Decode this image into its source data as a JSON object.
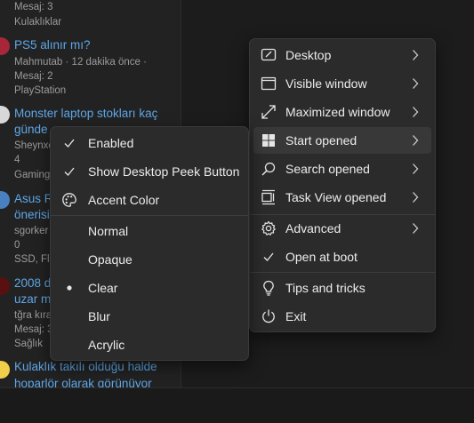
{
  "forum": {
    "posts": [
      {
        "meta1": "Mesaj: 3",
        "category": "Kulaklıklar"
      },
      {
        "title": "PS5 alınır mı?",
        "meta1": "Mahmutab · 12 dakika önce ·",
        "meta2": "Mesaj: 2",
        "category": "PlayStation"
      },
      {
        "title": "Monster laptop stokları kaç",
        "title2": "günde",
        "meta1": "Sheynxo",
        "meta2": "4",
        "category": "Gaming"
      },
      {
        "title": "Asus R",
        "title2": "önerisi",
        "meta1": "sgorker",
        "meta2": "0",
        "category": "SSD, Fla"
      },
      {
        "title": "2008 d",
        "title2": "uzar m",
        "meta1": "tğra kıra",
        "meta2": "Mesaj: 3",
        "category": "Sağlık"
      },
      {
        "title": "Kulaklık takılı olduğu halde",
        "title2": "hoparlör olarak görünüyor"
      }
    ]
  },
  "main_menu": {
    "items": [
      {
        "label": "Desktop",
        "icon": "desktop-icon",
        "submenu": true
      },
      {
        "label": "Visible window",
        "icon": "window-icon",
        "submenu": true
      },
      {
        "label": "Maximized window",
        "icon": "maximize-icon",
        "submenu": true
      },
      {
        "label": "Start opened",
        "icon": "windows-logo-icon",
        "submenu": true
      },
      {
        "label": "Search opened",
        "icon": "search-icon",
        "submenu": true
      },
      {
        "label": "Task View opened",
        "icon": "task-view-icon",
        "submenu": true
      },
      {
        "label": "Advanced",
        "icon": "gear-icon",
        "submenu": true
      },
      {
        "label": "Open at boot",
        "icon": "checkmark-icon",
        "checked": true
      },
      {
        "label": "Tips and tricks",
        "icon": "lightbulb-icon"
      },
      {
        "label": "Exit",
        "icon": "power-icon"
      }
    ]
  },
  "sub_menu": {
    "items": [
      {
        "label": "Enabled",
        "checked": true
      },
      {
        "label": "Show Desktop Peek Button",
        "checked": true
      },
      {
        "label": "Accent Color",
        "icon": "palette-icon"
      },
      {
        "label": "Normal"
      },
      {
        "label": "Opaque"
      },
      {
        "label": "Clear",
        "selected": true
      },
      {
        "label": "Blur"
      },
      {
        "label": "Acrylic"
      }
    ]
  }
}
